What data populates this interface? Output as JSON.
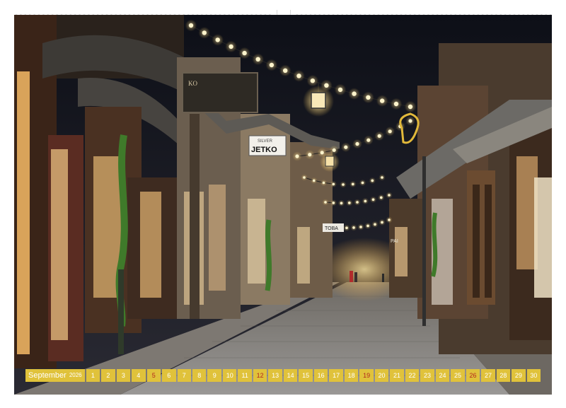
{
  "photo": {
    "sign_top": "KO",
    "sign_silver": "SILVER",
    "sign_jetko": "JETKO",
    "sign_mid": "TOBA",
    "sign_pai": "PAI"
  },
  "calendar": {
    "month": "September",
    "year": "2026",
    "days": [
      "1",
      "2",
      "3",
      "4",
      "5",
      "6",
      "7",
      "8",
      "9",
      "10",
      "11",
      "12",
      "13",
      "14",
      "15",
      "16",
      "17",
      "18",
      "19",
      "20",
      "21",
      "22",
      "23",
      "24",
      "25",
      "26",
      "27",
      "28",
      "29",
      "30"
    ],
    "sundays": [
      "5",
      "12",
      "19",
      "26"
    ],
    "strip_color": "#e0c23b",
    "sunday_color": "#b3261e"
  }
}
